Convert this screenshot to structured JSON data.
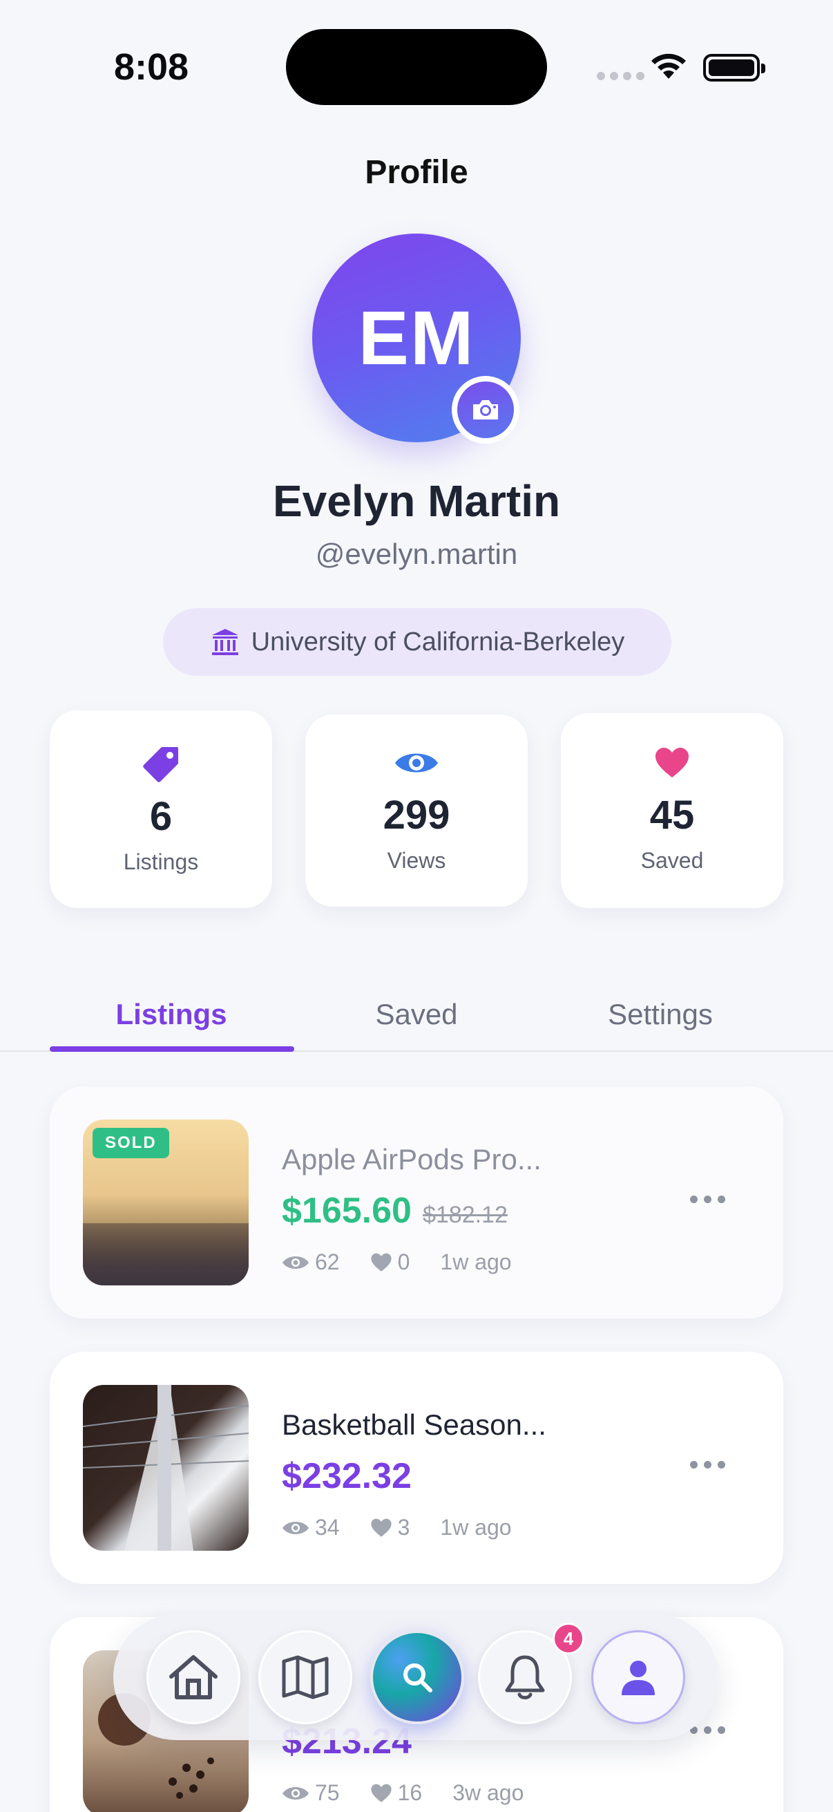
{
  "status_bar": {
    "time": "8:08"
  },
  "header": {
    "title": "Profile"
  },
  "profile": {
    "initials": "EM",
    "name": "Evelyn Martin",
    "handle": "@evelyn.martin",
    "school": "University of California-Berkeley"
  },
  "stats": [
    {
      "value": "6",
      "label": "Listings",
      "icon": "tag-icon",
      "color": "#7b3fe4"
    },
    {
      "value": "299",
      "label": "Views",
      "icon": "eye-icon",
      "color": "#3b7be8"
    },
    {
      "value": "45",
      "label": "Saved",
      "icon": "heart-icon",
      "color": "#e8458b"
    }
  ],
  "tabs": [
    {
      "label": "Listings",
      "active": true
    },
    {
      "label": "Saved",
      "active": false
    },
    {
      "label": "Settings",
      "active": false
    }
  ],
  "listings": [
    {
      "badge": "SOLD",
      "title": "Apple AirPods Pro...",
      "price": "$165.60",
      "old_price": "$182.12",
      "views": "62",
      "likes": "0",
      "age": "1w ago",
      "price_color": "#2fbf86"
    },
    {
      "title": "Basketball Season...",
      "price": "$232.32",
      "views": "34",
      "likes": "3",
      "age": "1w ago",
      "price_color": "#7b3fe4"
    },
    {
      "title": "",
      "price": "$213.24",
      "views": "75",
      "likes": "16",
      "age": "3w ago",
      "price_color": "#7b3fe4"
    }
  ],
  "bottom_nav": {
    "items": [
      "home-icon",
      "map-icon",
      "search-icon",
      "bell-icon",
      "user-icon"
    ],
    "notification_count": "4"
  },
  "colors": {
    "accent": "#7b3fe4",
    "success": "#2fbf86",
    "pink": "#e8458b",
    "blue": "#3b7be8"
  }
}
